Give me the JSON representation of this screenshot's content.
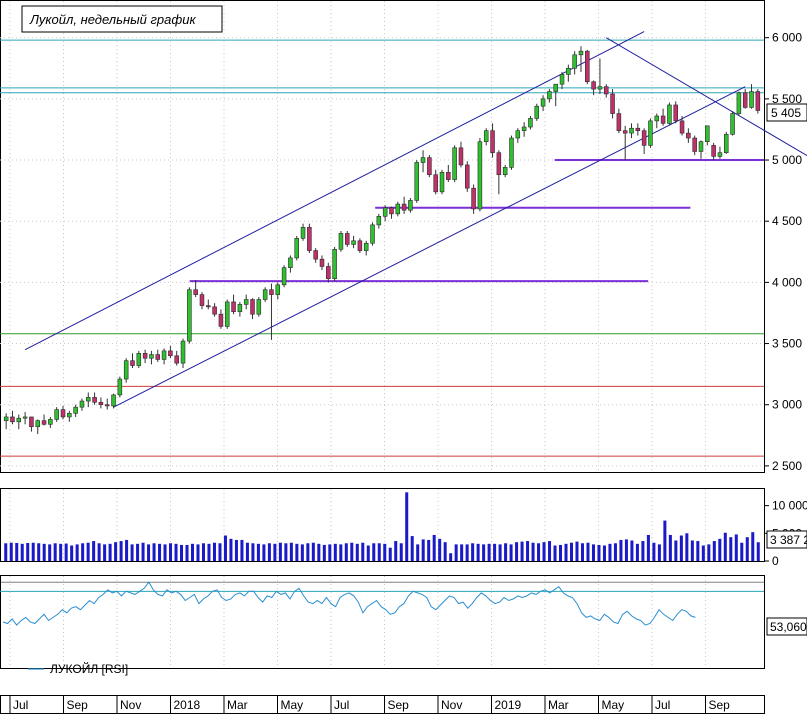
{
  "chart_data": {
    "type": "candlestick",
    "title": "Лукойл, недельный график",
    "price_axis": {
      "ticks": [
        2500,
        3000,
        3500,
        4000,
        4500,
        5000,
        5500,
        6000
      ],
      "tick_labels": [
        "2 500",
        "3 000",
        "3 500",
        "4 000",
        "4 500",
        "5 000",
        "5 500",
        "6 000"
      ],
      "ylim": [
        2450,
        6300
      ]
    },
    "last_price_label": "5 405",
    "time_axis": {
      "labels": [
        "Jul",
        "Sep",
        "Nov",
        "2018",
        "Mar",
        "May",
        "Jul",
        "Sep",
        "Nov",
        "2019",
        "Mar",
        "May",
        "Jul",
        "Sep"
      ]
    },
    "candles": [
      [
        2870,
        2930,
        2800,
        2900
      ],
      [
        2900,
        2950,
        2840,
        2860
      ],
      [
        2860,
        2920,
        2800,
        2890
      ],
      [
        2890,
        2940,
        2840,
        2900
      ],
      [
        2900,
        2900,
        2780,
        2820
      ],
      [
        2820,
        2880,
        2760,
        2870
      ],
      [
        2870,
        2920,
        2830,
        2840
      ],
      [
        2840,
        2900,
        2810,
        2880
      ],
      [
        2880,
        2980,
        2860,
        2960
      ],
      [
        2960,
        2990,
        2880,
        2900
      ],
      [
        2900,
        2950,
        2860,
        2930
      ],
      [
        2930,
        3000,
        2900,
        2980
      ],
      [
        2980,
        3050,
        2950,
        3030
      ],
      [
        3030,
        3100,
        2980,
        3060
      ],
      [
        3060,
        3100,
        3000,
        3020
      ],
      [
        3020,
        3060,
        2970,
        3000
      ],
      [
        3000,
        3050,
        2960,
        2990
      ],
      [
        2990,
        3090,
        2970,
        3080
      ],
      [
        3080,
        3230,
        3060,
        3210
      ],
      [
        3210,
        3380,
        3180,
        3360
      ],
      [
        3360,
        3420,
        3300,
        3320
      ],
      [
        3320,
        3440,
        3300,
        3420
      ],
      [
        3420,
        3450,
        3340,
        3380
      ],
      [
        3380,
        3440,
        3330,
        3410
      ],
      [
        3410,
        3450,
        3350,
        3370
      ],
      [
        3370,
        3460,
        3330,
        3440
      ],
      [
        3440,
        3480,
        3380,
        3400
      ],
      [
        3400,
        3440,
        3320,
        3340
      ],
      [
        3340,
        3540,
        3300,
        3520
      ],
      [
        3520,
        3960,
        3500,
        3940
      ],
      [
        3940,
        4020,
        3880,
        3900
      ],
      [
        3900,
        3920,
        3780,
        3810
      ],
      [
        3810,
        3860,
        3780,
        3800
      ],
      [
        3800,
        3830,
        3720,
        3740
      ],
      [
        3740,
        3780,
        3620,
        3640
      ],
      [
        3640,
        3860,
        3620,
        3840
      ],
      [
        3840,
        3900,
        3740,
        3760
      ],
      [
        3760,
        3840,
        3720,
        3820
      ],
      [
        3820,
        3900,
        3780,
        3860
      ],
      [
        3860,
        3870,
        3700,
        3740
      ],
      [
        3740,
        3880,
        3720,
        3860
      ],
      [
        3860,
        3960,
        3840,
        3940
      ],
      [
        3940,
        3990,
        3530,
        3900
      ],
      [
        3900,
        4000,
        3860,
        3980
      ],
      [
        3980,
        4140,
        3960,
        4120
      ],
      [
        4120,
        4220,
        4080,
        4200
      ],
      [
        4200,
        4380,
        4180,
        4360
      ],
      [
        4360,
        4480,
        4340,
        4450
      ],
      [
        4450,
        4480,
        4240,
        4260
      ],
      [
        4260,
        4280,
        4160,
        4190
      ],
      [
        4190,
        4220,
        4100,
        4130
      ],
      [
        4130,
        4160,
        4000,
        4030
      ],
      [
        4030,
        4290,
        4010,
        4270
      ],
      [
        4270,
        4420,
        4250,
        4400
      ],
      [
        4400,
        4420,
        4290,
        4310
      ],
      [
        4310,
        4380,
        4280,
        4340
      ],
      [
        4340,
        4360,
        4240,
        4260
      ],
      [
        4260,
        4340,
        4220,
        4320
      ],
      [
        4320,
        4490,
        4300,
        4470
      ],
      [
        4470,
        4560,
        4440,
        4540
      ],
      [
        4540,
        4630,
        4500,
        4610
      ],
      [
        4610,
        4620,
        4520,
        4560
      ],
      [
        4560,
        4660,
        4540,
        4640
      ],
      [
        4640,
        4700,
        4560,
        4590
      ],
      [
        4590,
        4690,
        4570,
        4670
      ],
      [
        4670,
        5000,
        4650,
        4980
      ],
      [
        4980,
        5080,
        4900,
        5020
      ],
      [
        5020,
        5040,
        4860,
        4880
      ],
      [
        4880,
        4920,
        4720,
        4740
      ],
      [
        4740,
        4920,
        4720,
        4900
      ],
      [
        4900,
        4960,
        4820,
        4840
      ],
      [
        4840,
        5120,
        4820,
        5100
      ],
      [
        5100,
        5150,
        4940,
        4960
      ],
      [
        4960,
        4990,
        4740,
        4770
      ],
      [
        4770,
        4800,
        4560,
        4600
      ],
      [
        4600,
        5180,
        4580,
        5150
      ],
      [
        5150,
        5260,
        5120,
        5240
      ],
      [
        5240,
        5300,
        5020,
        5060
      ],
      [
        5060,
        5080,
        4720,
        4880
      ],
      [
        4880,
        4960,
        4860,
        4940
      ],
      [
        4940,
        5200,
        4920,
        5180
      ],
      [
        5180,
        5260,
        5140,
        5240
      ],
      [
        5240,
        5310,
        5190,
        5270
      ],
      [
        5270,
        5360,
        5250,
        5340
      ],
      [
        5340,
        5460,
        5320,
        5440
      ],
      [
        5440,
        5530,
        5400,
        5500
      ],
      [
        5500,
        5580,
        5470,
        5560
      ],
      [
        5560,
        5620,
        5440,
        5620
      ],
      [
        5620,
        5720,
        5580,
        5700
      ],
      [
        5700,
        5780,
        5640,
        5750
      ],
      [
        5750,
        5890,
        5700,
        5860
      ],
      [
        5860,
        5930,
        5720,
        5890
      ],
      [
        5890,
        5900,
        5620,
        5640
      ],
      [
        5640,
        5650,
        5530,
        5580
      ],
      [
        5580,
        5830,
        5540,
        5600
      ],
      [
        5600,
        5620,
        5510,
        5540
      ],
      [
        5540,
        5580,
        5340,
        5380
      ],
      [
        5380,
        5420,
        5220,
        5240
      ],
      [
        5240,
        5280,
        5000,
        5220
      ],
      [
        5220,
        5300,
        5180,
        5260
      ],
      [
        5260,
        5300,
        5200,
        5240
      ],
      [
        5240,
        5260,
        5050,
        5120
      ],
      [
        5120,
        5340,
        5100,
        5320
      ],
      [
        5320,
        5380,
        5260,
        5360
      ],
      [
        5360,
        5420,
        5280,
        5300
      ],
      [
        5300,
        5470,
        5290,
        5450
      ],
      [
        5450,
        5480,
        5300,
        5320
      ],
      [
        5320,
        5360,
        5200,
        5220
      ],
      [
        5220,
        5260,
        5140,
        5180
      ],
      [
        5180,
        5200,
        5040,
        5070
      ],
      [
        5070,
        5160,
        5010,
        5150
      ],
      [
        5150,
        5270,
        5120,
        5280
      ],
      [
        5120,
        5140,
        5000,
        5030
      ],
      [
        5030,
        5110,
        5010,
        5060
      ],
      [
        5060,
        5230,
        5050,
        5210
      ],
      [
        5210,
        5400,
        5200,
        5380
      ],
      [
        5380,
        5560,
        5360,
        5550
      ],
      [
        5550,
        5580,
        5420,
        5430
      ],
      [
        5430,
        5620,
        5420,
        5560
      ],
      [
        5560,
        5580,
        5380,
        5405
      ]
    ],
    "volume": {
      "ticks": [
        0,
        5000,
        10000
      ],
      "tick_labels": [
        "0",
        "5 000",
        "10 000"
      ],
      "ylim": [
        0,
        13000
      ],
      "last_label": "3 387 2",
      "values": [
        3200,
        3300,
        3250,
        3100,
        3250,
        3300,
        3200,
        3100,
        3000,
        3200,
        3100,
        3150,
        2800,
        3000,
        3200,
        3300,
        3600,
        3200,
        3000,
        3100,
        3400,
        3600,
        3800,
        3000,
        3100,
        3300,
        3000,
        3200,
        3100,
        3000,
        3200,
        3100,
        2900,
        2900,
        3100,
        3000,
        3200,
        3100,
        3300,
        3200,
        4600,
        4000,
        3800,
        3800,
        3300,
        3200,
        3100,
        3000,
        3200,
        3100,
        3300,
        3200,
        3300,
        3100,
        3000,
        3200,
        3300,
        3100,
        2900,
        3000,
        3100,
        3000,
        3200,
        3300,
        3100,
        3300,
        2800,
        3200,
        3200,
        3100,
        2400,
        3600,
        3200,
        12400,
        4500,
        3000,
        3900,
        3800,
        4700,
        4000,
        3400,
        1400,
        3000,
        3000,
        3000,
        3200,
        3100,
        3000,
        3100,
        3100,
        3000,
        3200,
        3000,
        3400,
        3500,
        3600,
        3300,
        3200,
        3400,
        3600,
        2800,
        2900,
        3100,
        3300,
        3500,
        3200,
        3300,
        3000,
        2900,
        2800,
        3100,
        3200,
        3800,
        3900,
        3700,
        3100,
        3600,
        4700,
        3300,
        3000,
        7300,
        4700,
        3700,
        4600,
        5000,
        3700,
        3600,
        2800,
        3000,
        3600,
        4000,
        5100,
        4300,
        4800,
        3300,
        4300,
        5200,
        3387
      ]
    },
    "rsi": {
      "label": "ЛУКОЙЛ [RSI]",
      "last_label": "53,060",
      "upper_band": 70,
      "lower_band": 30,
      "ylim": [
        20,
        80
      ],
      "values": [
        50,
        49,
        52,
        48,
        51,
        53,
        50,
        49,
        52,
        55,
        51,
        53,
        55,
        58,
        56,
        59,
        60,
        58,
        61,
        64,
        62,
        66,
        68,
        71,
        69,
        70,
        67,
        70,
        69,
        68,
        70,
        72,
        76,
        71,
        68,
        67,
        71,
        69,
        70,
        68,
        64,
        66,
        68,
        62,
        65,
        67,
        70,
        71,
        66,
        64,
        65,
        68,
        69,
        67,
        70,
        70,
        66,
        63,
        67,
        66,
        70,
        68,
        69,
        65,
        70,
        72,
        67,
        63,
        62,
        64,
        62,
        66,
        62,
        60,
        66,
        68,
        69,
        67,
        63,
        56,
        60,
        62,
        64,
        60,
        58,
        55,
        56,
        60,
        62,
        67,
        70,
        69,
        68,
        66,
        60,
        58,
        61,
        64,
        67,
        66,
        62,
        63,
        59,
        62,
        66,
        69,
        67,
        64,
        62,
        63,
        66,
        64,
        65,
        67,
        66,
        67,
        69,
        68,
        70,
        71,
        69,
        71,
        73,
        69,
        67,
        66,
        62,
        56,
        53,
        54,
        52,
        51,
        55,
        53,
        50,
        49,
        55,
        57,
        54,
        52,
        51,
        48,
        49,
        53,
        58,
        55,
        53,
        51,
        55,
        58,
        57,
        54,
        53
      ]
    },
    "colors": {
      "up": "#2fbf2f",
      "down": "#c0306a",
      "volume": "#1a1ac8",
      "rsi": "#2a8fd0",
      "support": "#7b2fd6",
      "channel": "#1f1fa0",
      "level_cyan": "#2aa6b8",
      "level_green": "#2e9a2e",
      "level_red": "#d23b3b"
    }
  }
}
